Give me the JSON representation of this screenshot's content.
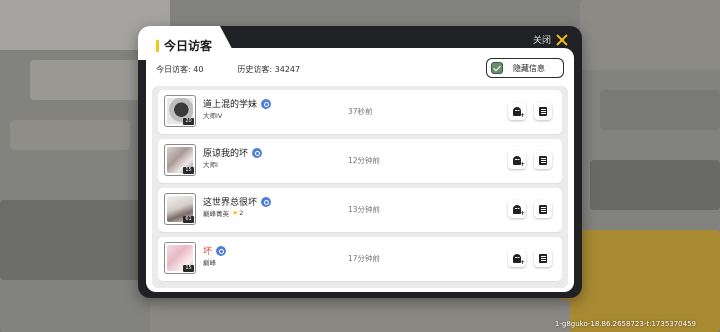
{
  "dialog": {
    "title": "今日访客",
    "close_label": "关闭",
    "today_visits": "今日访客: 40",
    "history_visits": "历史访客: 34247",
    "hide_info_label": "隐藏信息",
    "hide_info_checked": true
  },
  "visitors": [
    {
      "name": "道上混的学妹",
      "rank": "大师IV",
      "level": "20",
      "time": "37秒前",
      "name_color": "#1a1a1a",
      "stars": ""
    },
    {
      "name": "原谅我的坏",
      "rank": "大师I",
      "level": "15",
      "time": "12分钟前",
      "name_color": "#1a1a1a",
      "stars": ""
    },
    {
      "name": "这世界总很坏",
      "rank": "巅峰菁英",
      "level": "61",
      "time": "13分钟前",
      "name_color": "#1a1a1a",
      "stars": "2"
    },
    {
      "name": "坏",
      "rank": "巅峰",
      "level": "15",
      "time": "17分钟前",
      "name_color": "#e0483c",
      "stars": ""
    }
  ],
  "footer": {
    "build_id": "1-g8guko-18.86.2658723-t:1735370459"
  },
  "colors": {
    "accent": "#f5c21b",
    "gender_male": "#4f7fd8",
    "dialog_bg": "#1f2124"
  },
  "icons": {
    "close": "close-x-icon",
    "gender": "male-icon",
    "add_friend": "ghost-add-icon",
    "detail": "document-icon",
    "check": "checkmark-icon"
  }
}
